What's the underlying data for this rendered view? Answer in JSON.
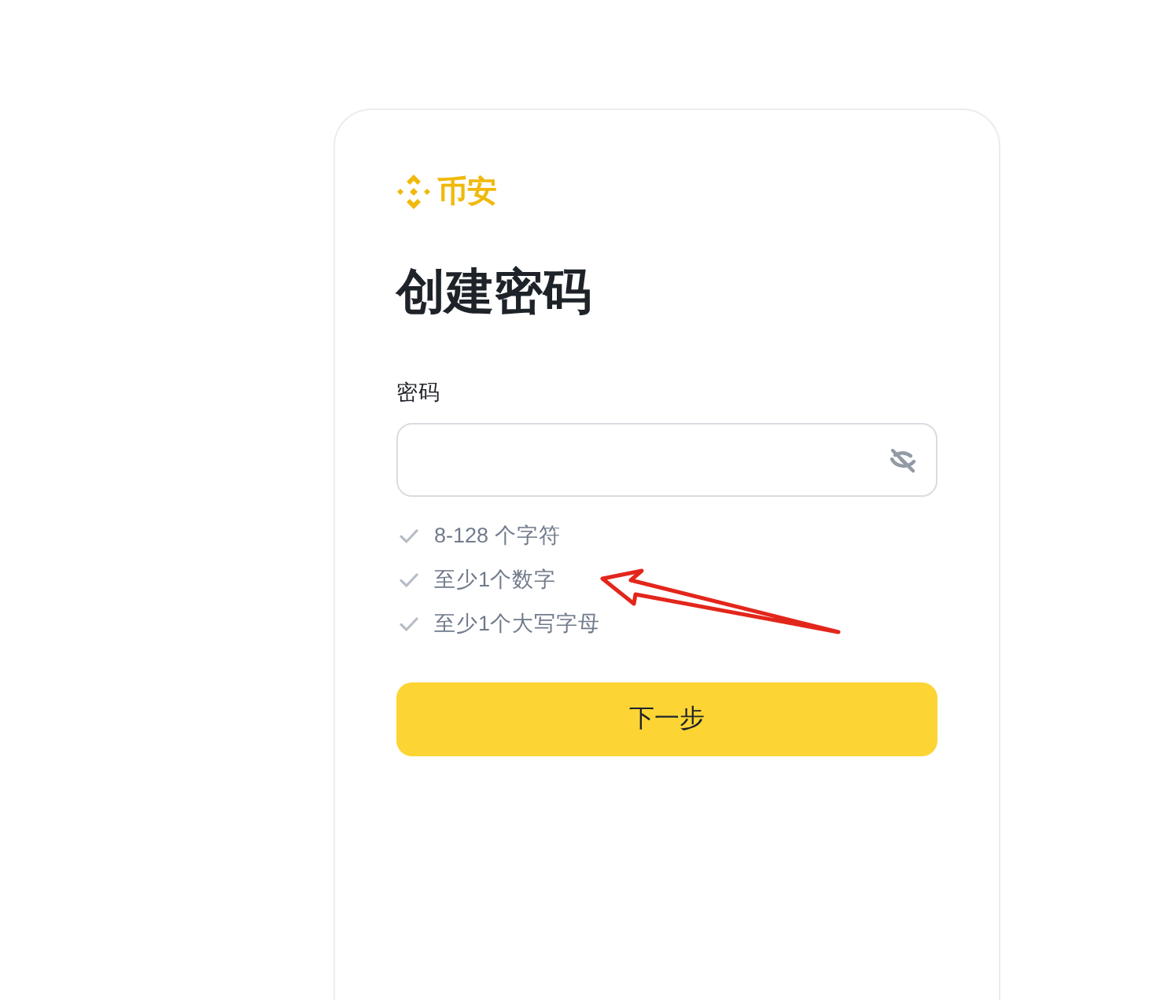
{
  "logo": {
    "text": "币安"
  },
  "title": "创建密码",
  "password_field": {
    "label": "密码",
    "password_visible": false
  },
  "requirements": [
    {
      "text": "8-128 个字符",
      "met": false
    },
    {
      "text": "至少1个数字",
      "met": false
    },
    {
      "text": "至少1个大写字母",
      "met": false
    }
  ],
  "next_button": {
    "label": "下一步"
  },
  "annotations": [
    {
      "kind": "arrow"
    }
  ]
}
